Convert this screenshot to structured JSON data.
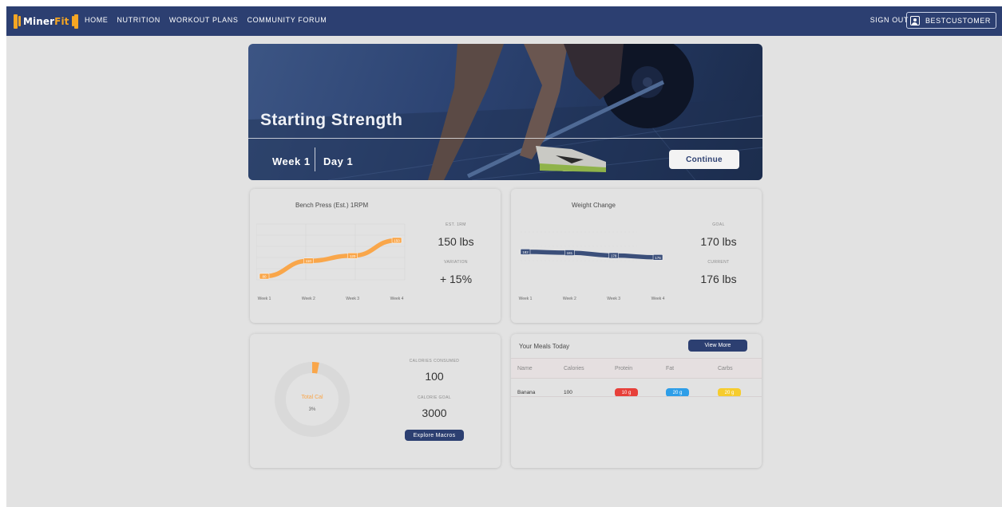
{
  "nav": {
    "brand_main": "Miner",
    "brand_accent": "Fit",
    "links": [
      "HOME",
      "NUTRITION",
      "WORKOUT PLANS",
      "COMMUNITY FORUM"
    ],
    "sign_out": "SIGN OUT",
    "username": "BESTCUSTOMER"
  },
  "hero": {
    "title": "Starting Strength",
    "week": "Week 1",
    "day": "Day 1",
    "continue": "Continue"
  },
  "bench": {
    "title": "Bench Press (Est.) 1RPM",
    "stat1_label": "EST. 1RM",
    "stat1_value": "150 lbs",
    "stat2_label": "VARIATION",
    "stat2_value": "+ 15%",
    "line_color": "#f9a64a"
  },
  "weight": {
    "title": "Weight Change",
    "stat1_label": "GOAL",
    "stat1_value": "170 lbs",
    "stat2_label": "CURRENT",
    "stat2_value": "176 lbs",
    "line_color": "#3b4f7a"
  },
  "chart_data": [
    {
      "type": "line",
      "categories": [
        "Week 1",
        "Week 2",
        "Week 3",
        "Week 4"
      ],
      "values": [
        80,
        110,
        120,
        150
      ],
      "title": "Bench Press (Est.) 1RPM"
    },
    {
      "type": "line",
      "categories": [
        "Week 1",
        "Week 2",
        "Week 3",
        "Week 4"
      ],
      "values": [
        182,
        181,
        178,
        176
      ],
      "title": "Weight Change"
    }
  ],
  "calories": {
    "donut_label": "Total Cal",
    "donut_percent": "3%",
    "percent_value": 3,
    "consumed_label": "CALORIES CONSUMED",
    "consumed_value": "100",
    "goal_label": "CALORIE GOAL",
    "goal_value": "3000",
    "button": "Explore Macros",
    "accent": "#f9a64a"
  },
  "meals": {
    "title": "Your Meals Today",
    "button": "View More",
    "columns": [
      "Name",
      "Calories",
      "Protein",
      "Fat",
      "Carbs"
    ],
    "rows": [
      {
        "name": "Banana",
        "calories": "100",
        "protein": "10 g",
        "fat": "20 g",
        "carbs": "20 g"
      }
    ],
    "colors": {
      "protein": "#e7403a",
      "fat": "#2e9ee8",
      "carbs": "#f6cc2e"
    }
  }
}
